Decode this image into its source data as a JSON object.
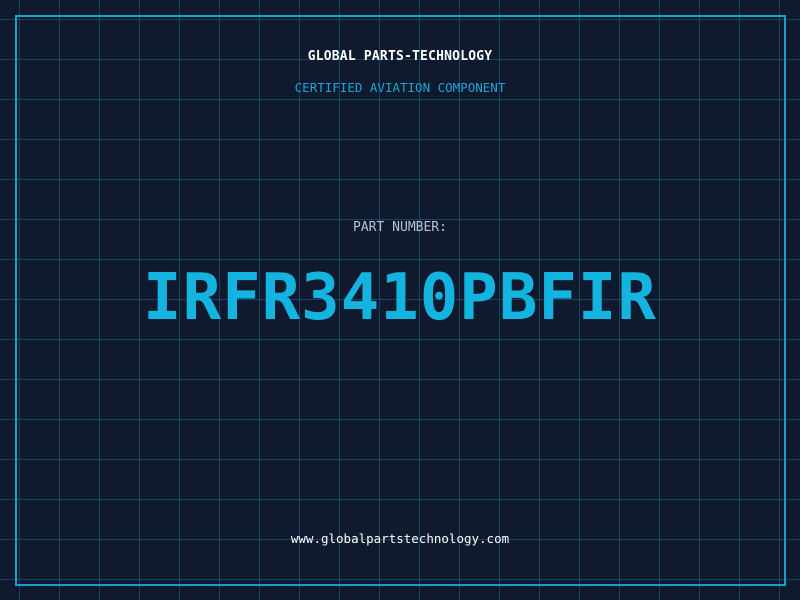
{
  "brand": {
    "company_name": "GLOBAL PARTS-TECHNOLOGY",
    "tagline": "CERTIFIED AVIATION COMPONENT"
  },
  "part": {
    "label": "PART NUMBER:",
    "number": "IRFR3410PBFIR"
  },
  "footer": {
    "website": "www.globalpartstechnology.com"
  },
  "colors": {
    "background": "#101a2e",
    "grid": "#1e6f8e",
    "frame": "#1a9fcf",
    "accent": "#14b4e0",
    "label": "#b4c2d3",
    "text": "#ffffff"
  }
}
